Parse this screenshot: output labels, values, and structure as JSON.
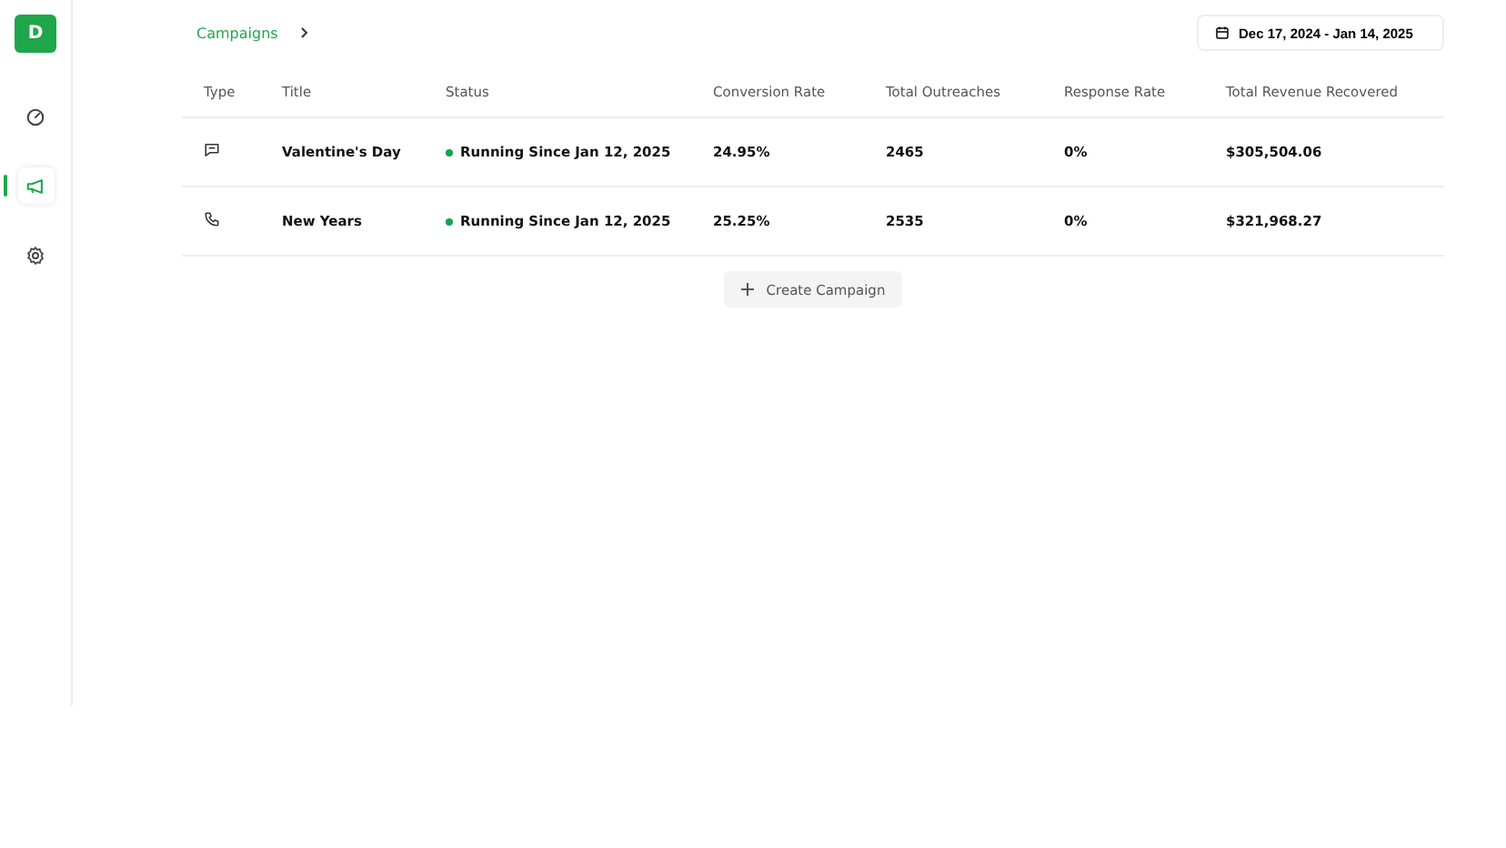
{
  "sidebar": {
    "logo": "D",
    "items": [
      {
        "kind": "gauge",
        "selected": false
      },
      {
        "kind": "megaphone",
        "selected": true
      },
      {
        "kind": "gear",
        "selected": false
      }
    ]
  },
  "breadcrumb": {
    "label": "Campaigns"
  },
  "date_range": "Dec 17, 2024 - Jan 14, 2025",
  "table": {
    "columns": [
      "Type",
      "Title",
      "Status",
      "Conversion Rate",
      "Total Outreaches",
      "Response Rate",
      "Total Revenue Recovered"
    ],
    "rows": [
      {
        "kind": "message",
        "title": "Valentine's Day",
        "status": "Running Since Jan 12, 2025",
        "color": "#16a34a",
        "conversion_rate": "24.95%",
        "total_outreaches": "2465",
        "response_rate": "0%",
        "revenue": "$305,504.06"
      },
      {
        "kind": "phone",
        "title": "New Years",
        "status": "Running Since Jan 12, 2025",
        "color": "#16a34a",
        "conversion_rate": "25.25%",
        "total_outreaches": "2535",
        "response_rate": "0%",
        "revenue": "$321,968.27"
      }
    ]
  },
  "create_button": "Create Campaign"
}
